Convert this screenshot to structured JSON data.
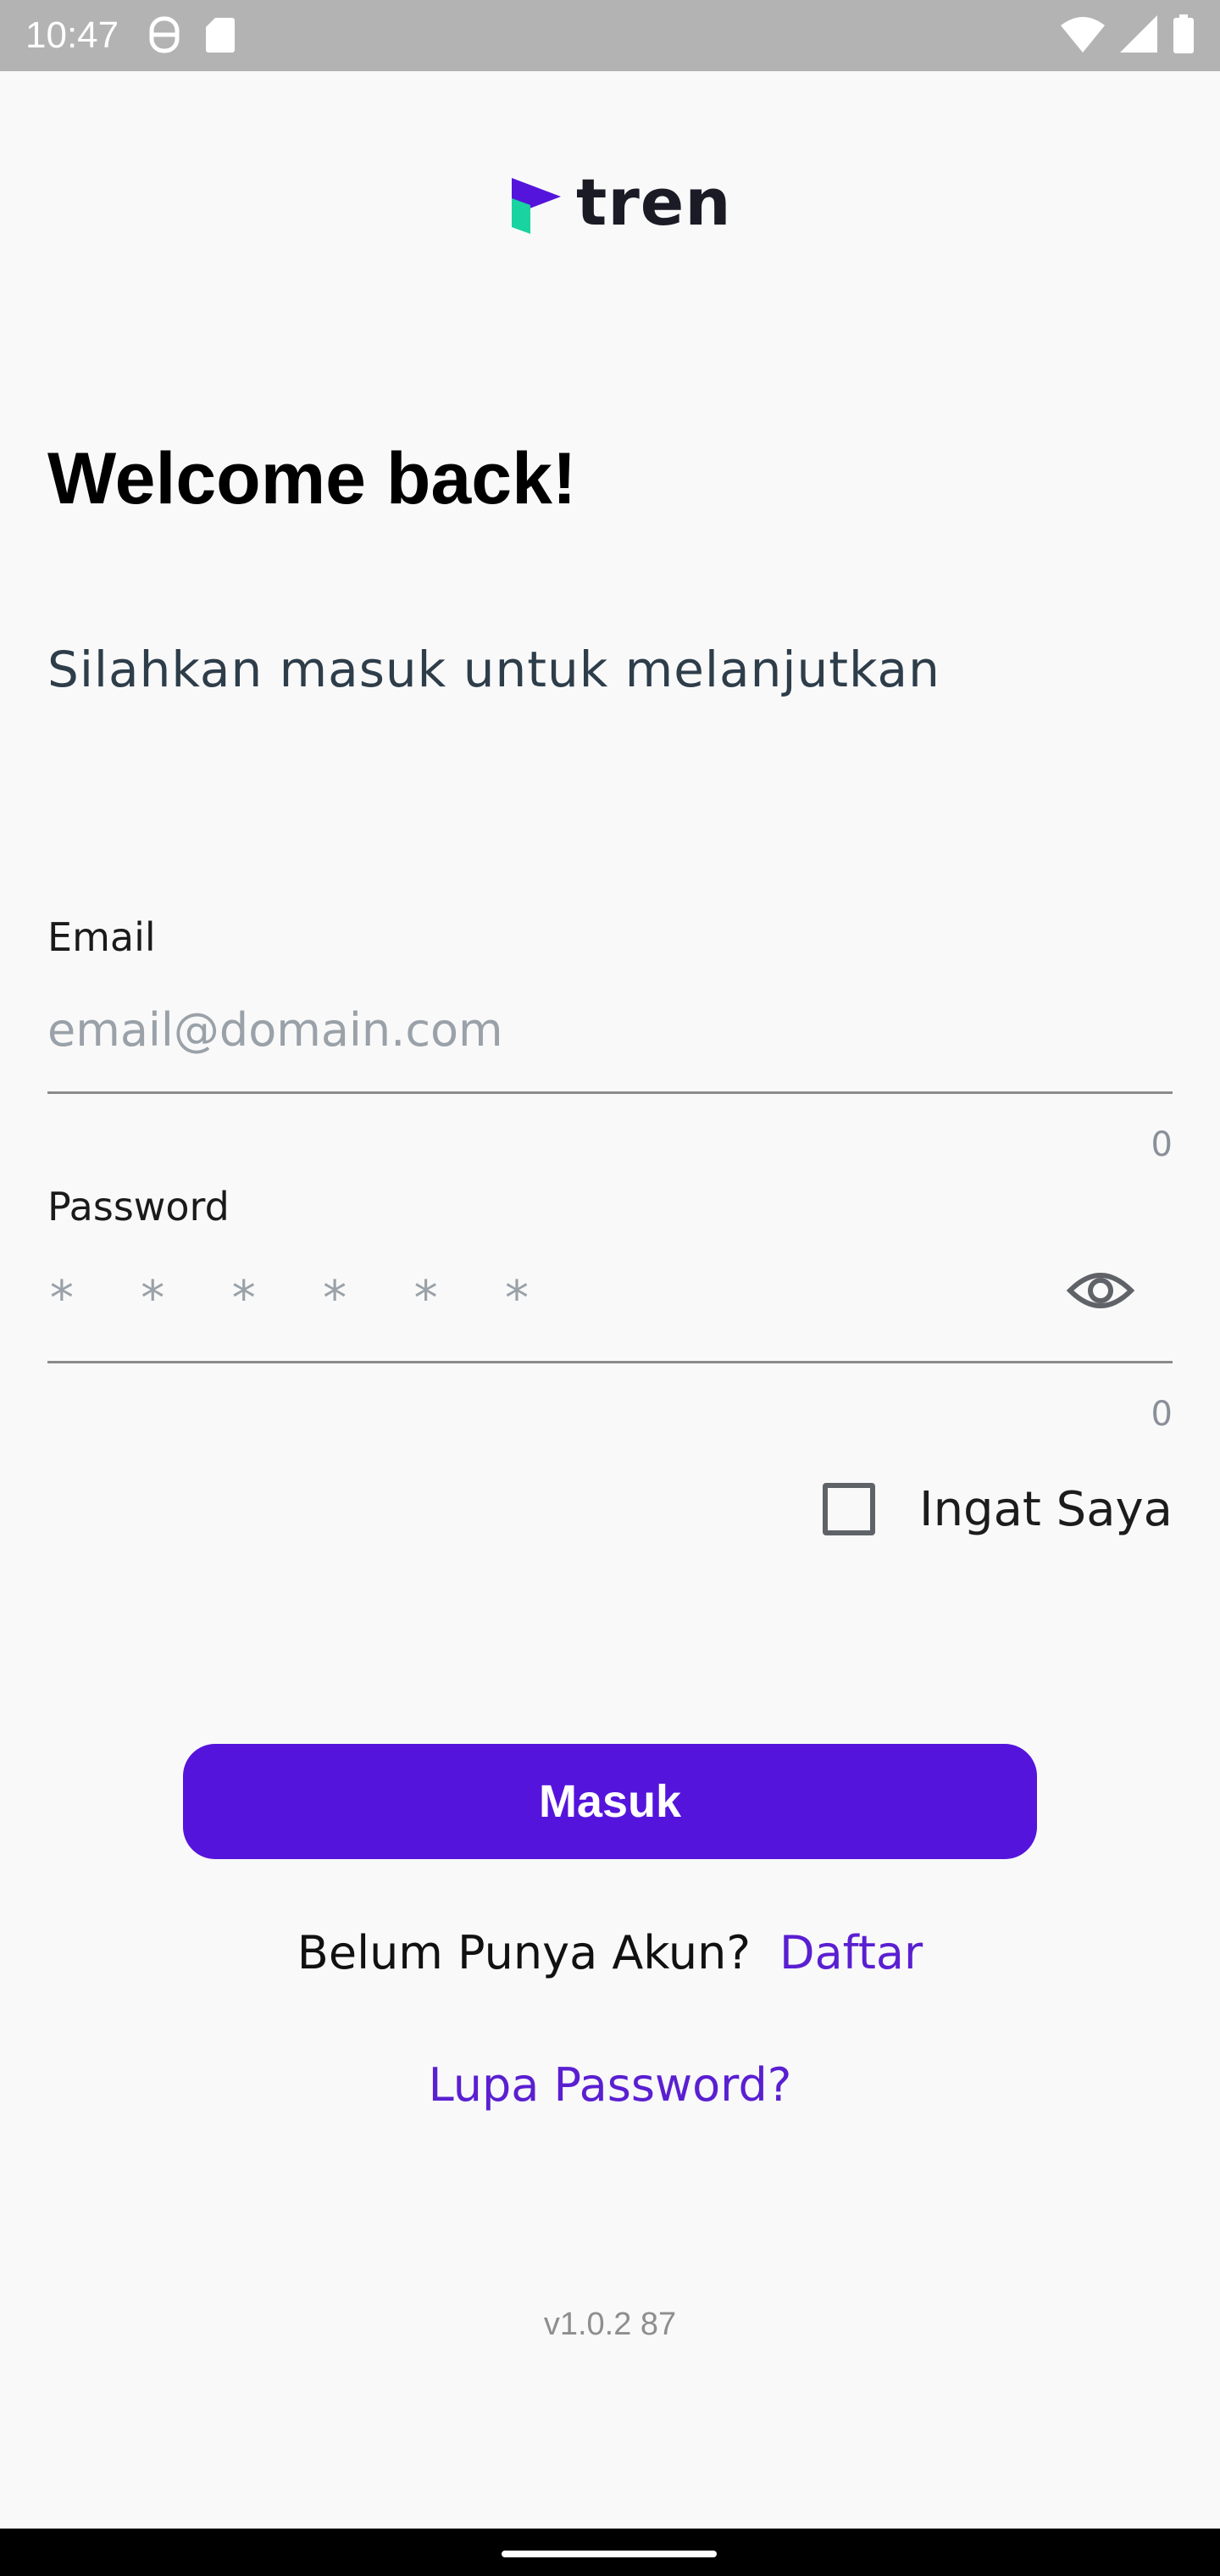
{
  "status_bar": {
    "time": "10:47",
    "left_icons": [
      "vpn-key-icon",
      "sd-card-icon"
    ],
    "right_icons": [
      "wifi-icon",
      "signal-icon",
      "battery-icon"
    ]
  },
  "logo": {
    "text": "tren",
    "colors": {
      "purple": "#5514dc",
      "green": "#19d3a0"
    }
  },
  "welcome": {
    "title": "Welcome back!",
    "subtitle": "Silahkan masuk untuk melanjutkan"
  },
  "email": {
    "label": "Email",
    "value": "",
    "placeholder": "email@domain.com",
    "counter": "0"
  },
  "password": {
    "label": "Password",
    "mask": "* * * * * *",
    "counter": "0",
    "toggle_icon": "eye-icon"
  },
  "remember": {
    "label": "Ingat Saya",
    "checked": false
  },
  "login_button": {
    "label": "Masuk"
  },
  "signup": {
    "prompt": "Belum Punya Akun?",
    "link": "Daftar"
  },
  "forgot": {
    "label": "Lupa Password?"
  },
  "version": "v1.0.2 87",
  "colors": {
    "accent": "#5514dc",
    "link": "#5a1fd1",
    "status_bar": "#b3b3b3"
  }
}
